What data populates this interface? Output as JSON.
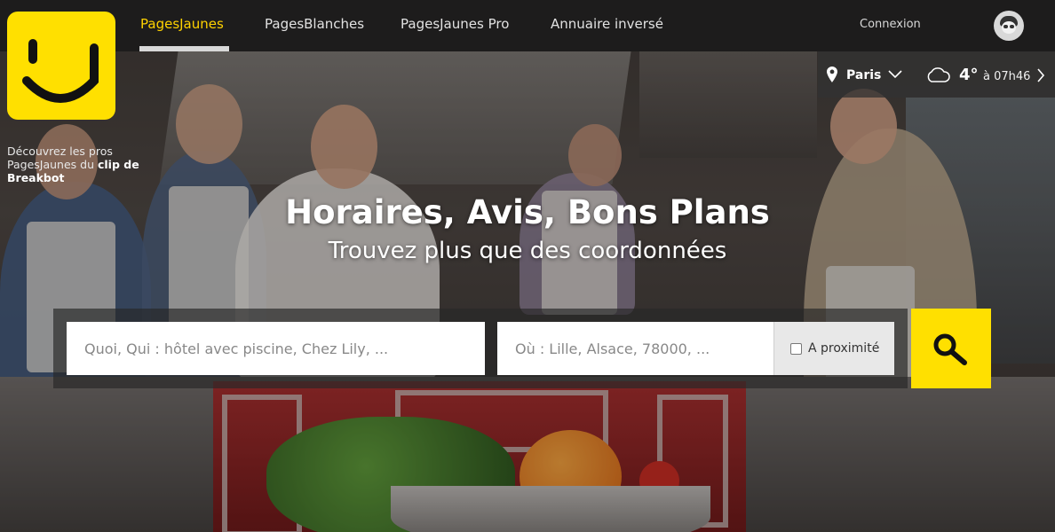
{
  "nav": {
    "items": [
      {
        "label": "PagesJaunes",
        "active": true
      },
      {
        "label": "PagesBlanches",
        "active": false
      },
      {
        "label": "PagesJaunes Pro",
        "active": false
      },
      {
        "label": "Annuaire inversé",
        "active": false
      }
    ],
    "login_label": "Connexion",
    "avatar_icon": "user-avatar-icon"
  },
  "logo": {
    "icon": "smiley-logo-icon",
    "color": "#ffe000"
  },
  "promo": {
    "text": "Découvrez les pros PagesJaunes du",
    "link_text": "clip de Breakbot"
  },
  "location": {
    "pin_icon": "location-pin-icon",
    "city": "Paris",
    "dropdown_icon": "chevron-down-icon"
  },
  "weather": {
    "icon": "cloud-icon",
    "temperature": "4°",
    "time": "à 07h46",
    "next_icon": "chevron-right-icon"
  },
  "hero": {
    "title": "Horaires, Avis, Bons Plans",
    "subtitle": "Trouvez plus que des coordonnées"
  },
  "search": {
    "what_placeholder": "Quoi, Qui : hôtel avec piscine, Chez Lily, ...",
    "where_placeholder": "Où : Lille, Alsace, 78000, ...",
    "nearby_label": "A proximité",
    "nearby_checked": false,
    "button_icon": "magnifier-icon"
  },
  "colors": {
    "brand_yellow": "#ffe000",
    "active_nav": "#ffd200"
  }
}
